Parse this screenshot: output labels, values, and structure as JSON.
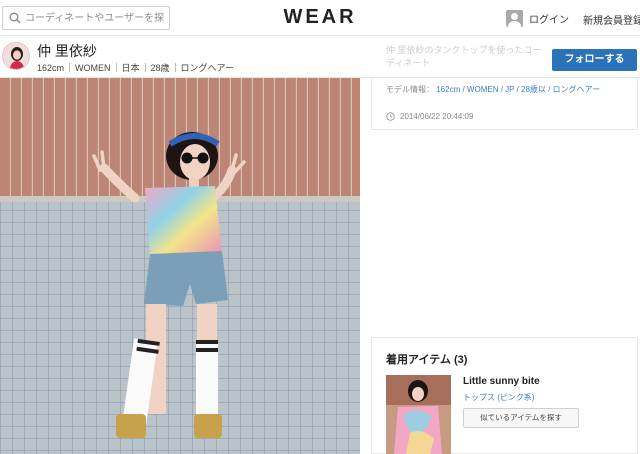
{
  "header": {
    "search_placeholder": "コーディネートやユーザーを探す",
    "logo": "WEAR",
    "login_label": "ログイン",
    "signup_label": "新規会員登録"
  },
  "profile": {
    "name": "仲 里依紗",
    "meta": [
      "162cm",
      "WOMEN",
      "日本",
      "28歳",
      "ロングヘアー"
    ],
    "follow_label": "フォローする"
  },
  "coordinate": {
    "title_partial": "仲 里依紗のタンクトップを使ったコーディネート",
    "model_info_label": "モデル情報：",
    "model_info_value": "162cm / WOMEN / JP / 28歳以 / ロングヘアー",
    "date": "2014/06/22 20:44:09"
  },
  "items": {
    "heading": "着用アイテム (3)",
    "list": [
      {
        "brand": "Little sunny bite",
        "category": "トップス (ピンク系)",
        "similar_label": "似ているアイテムを探す"
      }
    ]
  },
  "colors": {
    "accent_blue": "#2a73b8",
    "link_blue": "#3a7fc3",
    "wall_brick": "#b9826f",
    "wall_tile": "#a9b4bd"
  },
  "icons": {
    "search": "search-icon",
    "user": "user-icon",
    "clock": "clock-icon"
  }
}
